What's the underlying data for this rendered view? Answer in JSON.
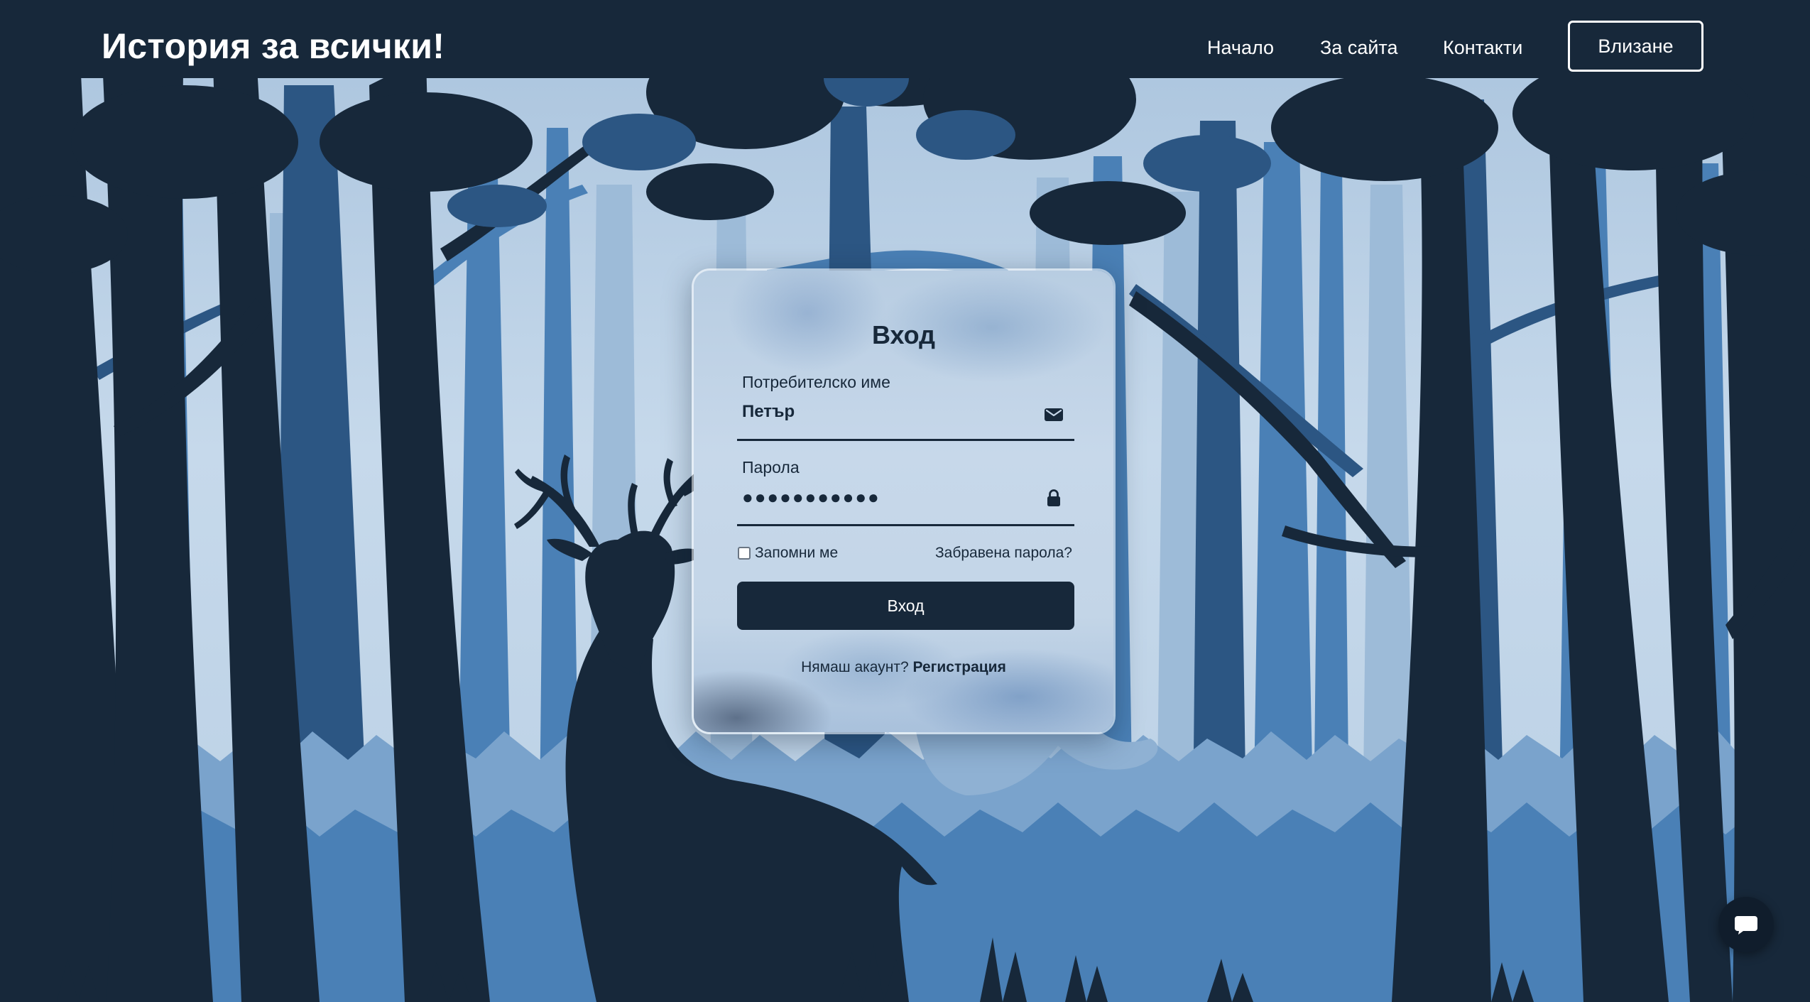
{
  "header": {
    "logo": "История за всички!",
    "nav": [
      "Начало",
      "За сайта",
      "Контакти"
    ],
    "login_button": "Влизане"
  },
  "login_form": {
    "title": "Вход",
    "username_label": "Потребителско име",
    "username_value": "Петър",
    "password_label": "Парола",
    "password_value": "●●●●●●●●●●●",
    "remember_label": "Запомни ме",
    "remember_checked": false,
    "forgot_link": "Забравена парола?",
    "submit_label": "Вход",
    "no_account_text": "Нямаш акаунт?",
    "register_link": "Регистрация"
  },
  "icons": {
    "username_icon": "envelope-icon",
    "password_icon": "lock-icon",
    "chat_icon": "chat-bubble-icon"
  },
  "colors": {
    "primary_dark": "#17283a",
    "sky_light": "#c3d6e8",
    "forest_mid": "#4a80b6",
    "forest_dark": "#1b3a5c"
  }
}
